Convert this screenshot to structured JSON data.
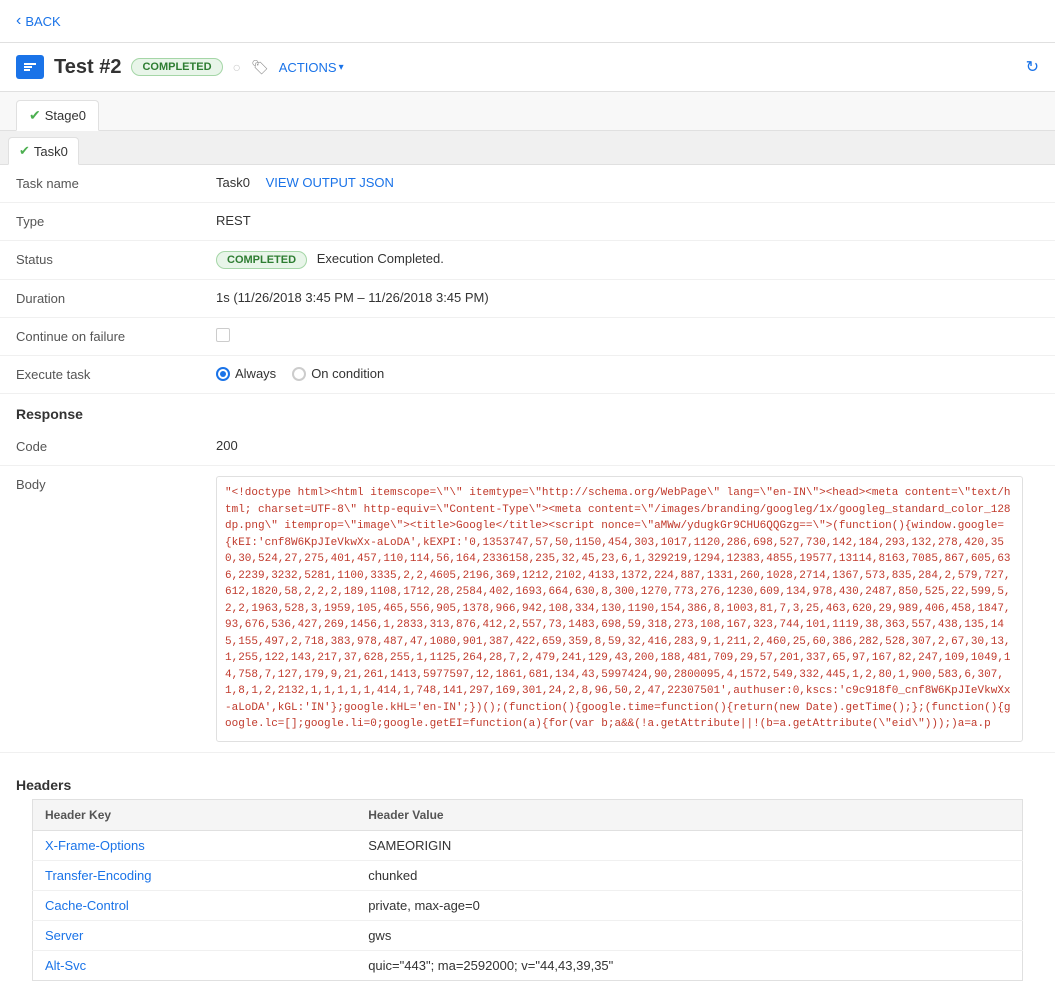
{
  "back": {
    "label": "BACK"
  },
  "header": {
    "title": "Test #2",
    "status": "COMPLETED",
    "icon": "⬛",
    "actions_label": "ACTIONS",
    "tag_icon": "🏷"
  },
  "stages": [
    {
      "label": "Stage0",
      "active": true,
      "completed": true
    }
  ],
  "tasks": [
    {
      "label": "Task0",
      "active": true,
      "completed": true
    }
  ],
  "details": {
    "task_name_label": "Task name",
    "task_name_value": "Task0",
    "view_output_label": "VIEW OUTPUT JSON",
    "type_label": "Type",
    "type_value": "REST",
    "status_label": "Status",
    "status_badge": "COMPLETED",
    "status_text": "Execution Completed.",
    "duration_label": "Duration",
    "duration_value": "1s (11/26/2018 3:45 PM – 11/26/2018 3:45 PM)",
    "continue_on_failure_label": "Continue on failure",
    "execute_task_label": "Execute task",
    "execute_always_label": "Always",
    "execute_condition_label": "On condition"
  },
  "response": {
    "section_label": "Response",
    "code_label": "Code",
    "code_value": "200",
    "body_label": "Body",
    "body_content": "\"<!doctype html><html itemscope=\\\"\\\" itemtype=\\\"http://schema.org/WebPage\\\" lang=\\\"en-IN\\\"><head><meta content=\\\"text/html; charset=UTF-8\\\" http-equiv=\\\"Content-Type\\\"><meta content=\\\"/images/branding/googleg/1x/googleg_standard_color_128dp.png\\\" itemprop=\\\"image\\\"><title>Google</title><script nonce=\\\"aMWw/ydugkGr9CHU6QQGzg==\\\">(function(){window.google={kEI:'cnf8W6KpJIeVkwXx-aLoDA',kEXPI:'0,1353747,57,50,1150,454,303,1017,1120,286,698,527,730,142,184,293,132,278,420,350,30,524,27,275,401,457,110,114,56,164,2336158,235,32,45,23,6,1,329219,1294,12383,4855,19577,13114,8163,7085,867,605,636,2239,3232,5281,1100,3335,2,2,4605,2196,369,1212,2102,4133,1372,224,887,1331,260,1028,2714,1367,573,835,284,2,579,727,612,1820,58,2,2,2,189,1108,1712,28,2584,402,1693,664,630,8,300,1270,773,276,1230,609,134,978,430,2487,850,525,22,599,5,2,2,1963,528,3,1959,105,465,556,905,1378,966,942,108,334,130,1190,154,386,8,1003,81,7,3,25,463,620,29,989,406,458,1847,93,676,536,427,269,1456,1,2833,313,876,412,2,557,73,1483,698,59,318,273,108,167,323,744,101,1119,38,363,557,438,135,145,155,497,2,718,383,978,487,47,1080,901,387,422,659,359,8,59,32,416,283,9,1,211,2,460,25,60,386,282,528,307,2,67,30,13,1,255,122,143,217,37,628,255,1,1125,264,28,7,2,479,241,129,43,200,188,481,709,29,57,201,337,65,97,167,82,247,109,1049,14,758,7,127,179,9,21,261,1413,5977597,12,1861,681,134,43,5997424,90,2800095,4,1572,549,332,445,1,2,80,1,900,583,6,307,1,8,1,2,2132,1,1,1,1,1,414,1,748,141,297,169,301,24,2,8,96,50,2,47,22307501',authuser:0,kscs:'c9c918f0_cnf8W6KpJIeVkwXx-aLoDA',kGL:'IN'};google.kHL='en-IN';})();(function(){google.time=function(){return(new Date).getTime();};(function(){google.lc=[];google.li=0;google.getEI=function(a){for(var b;a&&(!a.getAttribute||!(b=a.getAttribute(\\\"eid\\\")));)a=a.p"
  },
  "headers": {
    "section_label": "Headers",
    "col_key": "Header Key",
    "col_value": "Header Value",
    "rows": [
      {
        "key": "X-Frame-Options",
        "value": "SAMEORIGIN"
      },
      {
        "key": "Transfer-Encoding",
        "value": "chunked"
      },
      {
        "key": "Cache-Control",
        "value": "private, max-age=0"
      },
      {
        "key": "Server",
        "value": "gws"
      },
      {
        "key": "Alt-Svc",
        "value": "quic=\"443\"; ma=2592000; v=\"44,43,39,35\""
      }
    ]
  }
}
